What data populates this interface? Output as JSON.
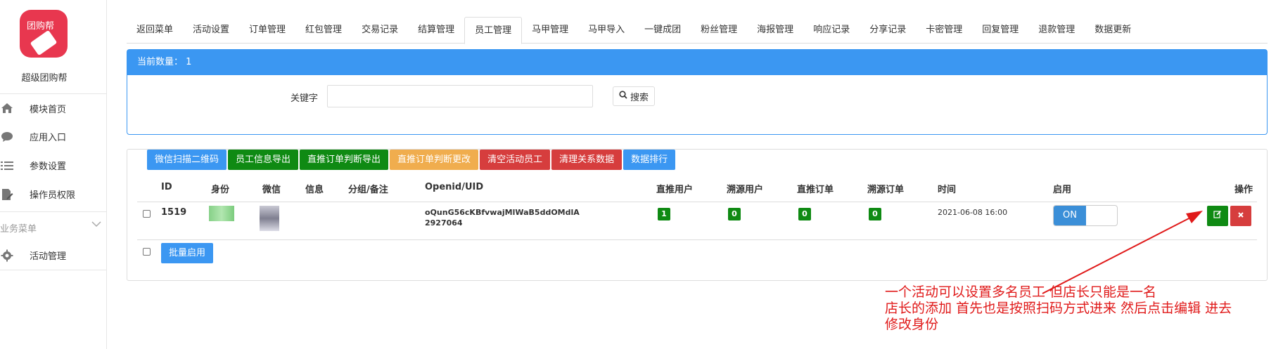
{
  "sidebar": {
    "brand_text": "团购帮",
    "brand_name": "超级团购帮",
    "items": [
      {
        "label": "模块首页",
        "icon": "home-icon"
      },
      {
        "label": "应用入口",
        "icon": "chat-icon"
      },
      {
        "label": "参数设置",
        "icon": "list-icon"
      },
      {
        "label": "操作员权限",
        "icon": "document-edit-icon"
      }
    ],
    "group_label": "业务菜单",
    "group_items": [
      {
        "label": "活动管理",
        "icon": "gear-icon"
      }
    ]
  },
  "tabs": [
    "返回菜单",
    "活动设置",
    "订单管理",
    "红包管理",
    "交易记录",
    "结算管理",
    "员工管理",
    "马甲管理",
    "马甲导入",
    "一键成团",
    "粉丝管理",
    "海报管理",
    "响应记录",
    "分享记录",
    "卡密管理",
    "回复管理",
    "退款管理",
    "数据更新"
  ],
  "active_tab": "员工管理",
  "search_panel": {
    "count_label": "当前数量：",
    "count_value": "1",
    "keyword_label": "关键字",
    "keyword_value": "",
    "search_button": "搜索"
  },
  "actions": [
    {
      "label": "微信扫描二维码",
      "color": "#3b97f2"
    },
    {
      "label": "员工信息导出",
      "color": "#0f8a13"
    },
    {
      "label": "直推订单判断导出",
      "color": "#0f8a13"
    },
    {
      "label": "直推订单判断更改",
      "color": "#f0ad4e"
    },
    {
      "label": "清空活动员工",
      "color": "#d63d3d"
    },
    {
      "label": "清理关系数据",
      "color": "#d63d3d"
    },
    {
      "label": "数据排行",
      "color": "#3b97f2"
    }
  ],
  "table": {
    "headers": {
      "id": "ID",
      "role": "身份",
      "wechat": "微信",
      "info": "信息",
      "group": "分组/备注",
      "openid": "Openid/UID",
      "direct_users": "直推用户",
      "source_users": "溯源用户",
      "direct_orders": "直推订单",
      "source_orders": "溯源订单",
      "time": "时间",
      "enabled": "启用",
      "actions": "操作"
    },
    "rows": [
      {
        "id": "1519",
        "openid_line1": "oQunG56cKBfvwajMlWaB5ddOMdlA",
        "openid_line2": "2927064",
        "direct_users": "1",
        "source_users": "0",
        "direct_orders": "0",
        "source_orders": "0",
        "time": "2021-06-08 16:00",
        "toggle_label": "ON"
      }
    ],
    "bulk_button": "批量启用"
  },
  "annotation": {
    "line1": "一个活动可以设置多名员工 但店长只能是一名",
    "line2": "店长的添加 首先也是按照扫码方式进来 然后点击编辑  进去",
    "line3": "修改身份",
    "color": "#e01a1a"
  }
}
